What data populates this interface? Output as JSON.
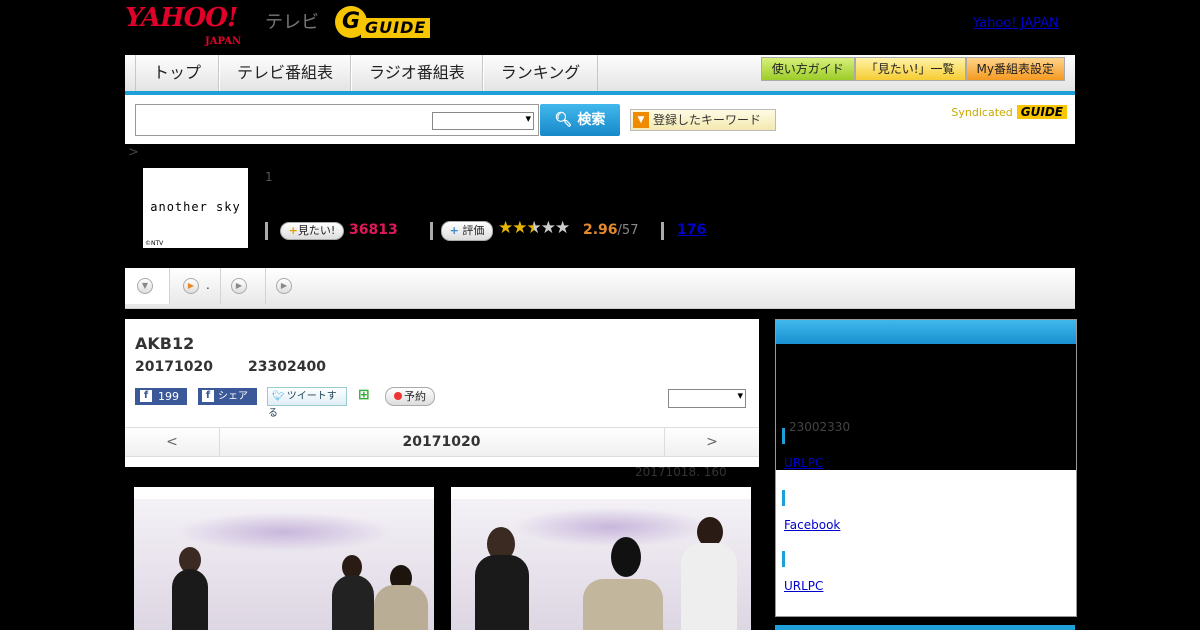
{
  "header": {
    "yahoo_logo": "YAHOO!",
    "japan": "JAPAN",
    "tv_label": "テレビ",
    "gguide_g": "G",
    "gguide_rest": "GUIDE",
    "yahoo_japan_link": "Yahoo! JAPAN"
  },
  "nav": {
    "tabs": [
      "トップ",
      "テレビ番組表",
      "ラジオ番組表",
      "ランキング"
    ],
    "buttons": [
      "使い方ガイド",
      "「見たい!」一覧",
      "My番組表設定"
    ]
  },
  "search": {
    "input_value": "",
    "select_value": "",
    "button_label": "検索",
    "keyword_button": "登録したキーワード",
    "syndicated": "Syndicated",
    "syndicated_logo": "GUIDE"
  },
  "breadcrumb": ">",
  "program": {
    "thumb_title": "another sky",
    "thumb_copyright": "©NTV",
    "episode": "1",
    "mitai_label": "見たい!",
    "mitai_count": "36813",
    "hyouka_label": "評価",
    "rating": 2.5,
    "score": "2.96",
    "score_total": "/57",
    "review_count": "176"
  },
  "subnav": {
    "item2_label": "."
  },
  "detail": {
    "title": "AKB12",
    "date": "20171020",
    "time": "23302400",
    "fb_count": "199",
    "fb_share": "シェア",
    "tweet": "ツイートする",
    "reserve": "予約",
    "select_value": "",
    "prev": "<",
    "current_date": "20171020",
    "next": ">",
    "note": "20171018. 160"
  },
  "sidebar": {
    "time": "23002330",
    "link1": "URLPC",
    "link2": "Facebook",
    "link3": "URLPC"
  },
  "colors": {
    "accent": "#1e9fd8",
    "mitai_count": "#e0185a",
    "score": "#e58a2b"
  }
}
